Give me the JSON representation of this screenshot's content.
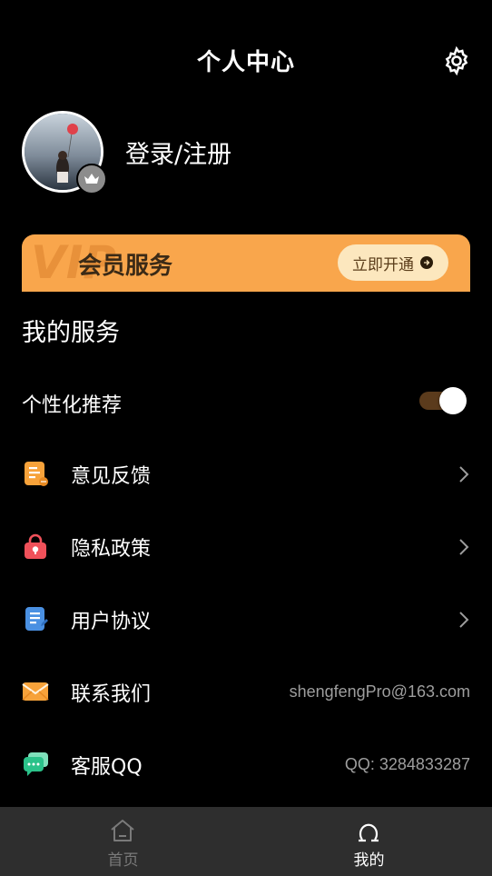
{
  "header": {
    "title": "个人中心",
    "settings_icon": "gear-icon"
  },
  "profile": {
    "login_text": "登录/注册",
    "badge_icon": "crown-icon"
  },
  "vip": {
    "watermark": "VIP",
    "title": "会员服务",
    "button_label": "立即开通",
    "button_icon": "arrow-right-icon",
    "color": "#f9a64c"
  },
  "services": {
    "title": "我的服务",
    "personalized": {
      "label": "个性化推荐",
      "enabled": true
    },
    "items": [
      {
        "label": "意见反馈",
        "icon": "feedback-icon",
        "color": "#f7a23a"
      },
      {
        "label": "隐私政策",
        "icon": "privacy-lock-icon",
        "color": "#f0515a"
      },
      {
        "label": "用户协议",
        "icon": "agreement-icon",
        "color": "#4a90e2"
      },
      {
        "label": "联系我们",
        "icon": "mail-icon",
        "color": "#f7a23a",
        "value": "shengfengPro@163.com"
      },
      {
        "label": "客服QQ",
        "icon": "chat-icon",
        "color": "#2bc28a",
        "value": "QQ: 3284833287"
      }
    ]
  },
  "nav": {
    "items": [
      {
        "label": "首页",
        "icon": "home-icon",
        "active": false
      },
      {
        "label": "我的",
        "icon": "profile-icon",
        "active": true
      }
    ],
    "active_color": "#ffffff",
    "inactive_color": "#7a7a7a"
  }
}
